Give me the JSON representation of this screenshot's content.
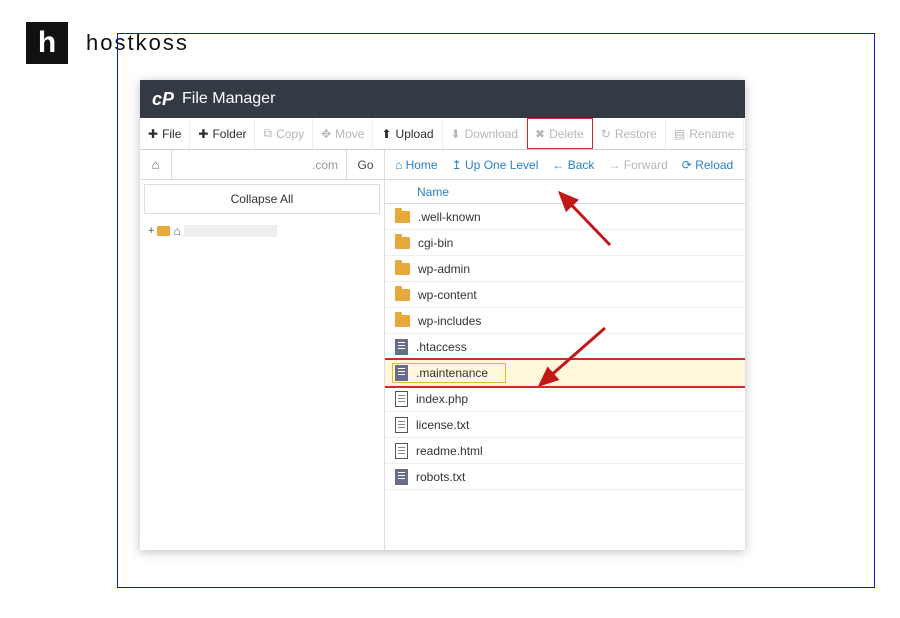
{
  "brand": {
    "mark": "h",
    "name": "hostkoss"
  },
  "app": {
    "title": "File Manager"
  },
  "toolbar": {
    "file": "File",
    "folder": "Folder",
    "copy": "Copy",
    "move": "Move",
    "upload": "Upload",
    "download": "Download",
    "delete": "Delete",
    "restore": "Restore",
    "rename": "Rename"
  },
  "address": {
    "domain": ".com",
    "go": "Go"
  },
  "left": {
    "collapse": "Collapse All",
    "tree_label": "hidden"
  },
  "nav": {
    "home": "Home",
    "up": "Up One Level",
    "back": "Back",
    "forward": "Forward",
    "reload": "Reload"
  },
  "columns": {
    "name": "Name"
  },
  "files": [
    {
      "name": ".well-known",
      "type": "folder"
    },
    {
      "name": "cgi-bin",
      "type": "folder"
    },
    {
      "name": "wp-admin",
      "type": "folder"
    },
    {
      "name": "wp-content",
      "type": "folder"
    },
    {
      "name": "wp-includes",
      "type": "folder"
    },
    {
      "name": ".htaccess",
      "type": "doc"
    },
    {
      "name": ".maintenance",
      "type": "doc",
      "selected": true
    },
    {
      "name": "index.php",
      "type": "docline"
    },
    {
      "name": "license.txt",
      "type": "docline"
    },
    {
      "name": "readme.html",
      "type": "docline"
    },
    {
      "name": "robots.txt",
      "type": "doc"
    }
  ]
}
